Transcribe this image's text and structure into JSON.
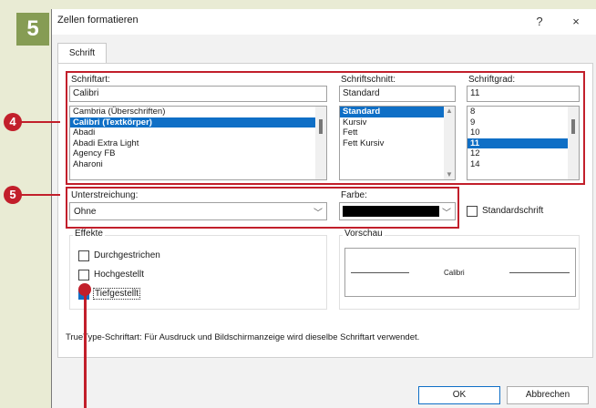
{
  "step_badge": "5",
  "dialog": {
    "title": "Zellen formatieren",
    "help": "?",
    "close": "×",
    "tab": "Schrift",
    "font": {
      "label": "Schriftart:",
      "value": "Calibri",
      "items": [
        "Cambria (Überschriften)",
        "Calibri (Textkörper)",
        "Abadi",
        "Abadi Extra Light",
        "Agency FB",
        "Aharoni"
      ],
      "selected_index": 1
    },
    "style": {
      "label": "Schriftschnitt:",
      "value": "Standard",
      "items": [
        "Standard",
        "Kursiv",
        "Fett",
        "Fett Kursiv"
      ],
      "selected_index": 0
    },
    "size": {
      "label": "Schriftgrad:",
      "value": "11",
      "items": [
        "8",
        "9",
        "10",
        "11",
        "12",
        "14"
      ],
      "selected_index": 3
    },
    "underline": {
      "label": "Unterstreichung:",
      "value": "Ohne"
    },
    "color": {
      "label": "Farbe:",
      "swatch": "#000000"
    },
    "standard_font": {
      "label": "Standardschrift",
      "checked": false
    },
    "effects": {
      "label": "Effekte",
      "strikethrough": {
        "label": "Durchgestrichen",
        "checked": false
      },
      "superscript": {
        "label": "Hochgestellt",
        "checked": false
      },
      "subscript": {
        "label": "Tiefgestellt",
        "checked": true
      }
    },
    "preview": {
      "label": "Vorschau",
      "sample": "Calibri"
    },
    "info": "TrueType-Schriftart: Für Ausdruck und Bildschirmanzeige wird dieselbe Schriftart verwendet.",
    "ok": "OK",
    "cancel": "Abbrechen"
  },
  "annotations": {
    "badge4": "4",
    "badge5": "5"
  },
  "colors": {
    "accent": "#c21f2b",
    "selection": "#0f6fc6",
    "step_badge_bg": "#869c54",
    "background": "#e9ebd4"
  }
}
